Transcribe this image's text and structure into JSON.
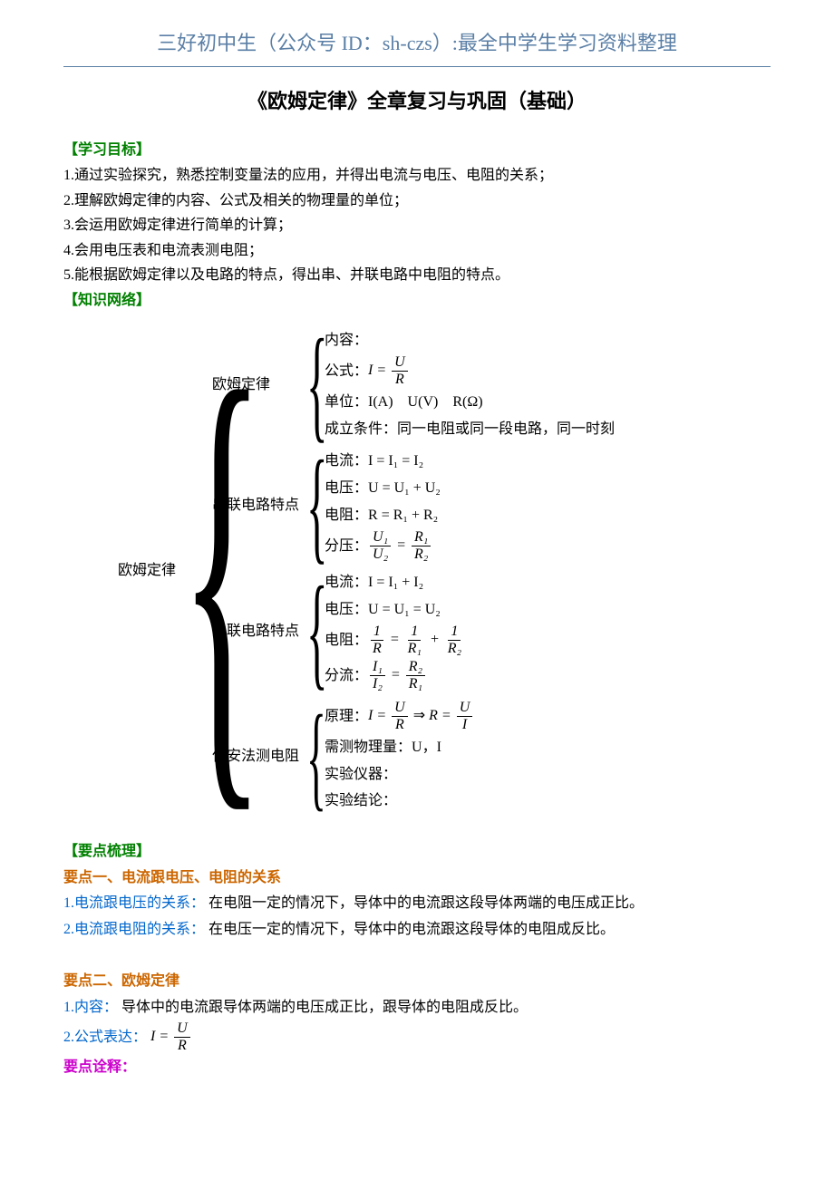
{
  "header": "三好初中生（公众号 ID：sh-czs）:最全中学生学习资料整理",
  "title": "《欧姆定律》全章复习与巩固（基础）",
  "sections": {
    "goals_label": "【学习目标】",
    "goals": [
      "1.通过实验探究，熟悉控制变量法的应用，并得出电流与电压、电阻的关系；",
      "2.理解欧姆定律的内容、公式及相关的物理量的单位；",
      "3.会运用欧姆定律进行简单的计算；",
      "4.会用电压表和电流表测电阻；",
      "5.能根据欧姆定律以及电路的特点，得出串、并联电路中电阻的特点。"
    ],
    "network_label": "【知识网络】",
    "tree": {
      "root": "欧姆定律",
      "b1": {
        "label": "欧姆定律",
        "i1": "内容：",
        "i2_prefix": "公式：",
        "i2_I": "I",
        "i2_U": "U",
        "i2_R": "R",
        "i3": "单位：I(A)　U(V)　R(Ω)",
        "i4": "成立条件：同一电阻或同一段电路，同一时刻"
      },
      "b2": {
        "label": "串联电路特点",
        "i1": "电流：I = I₁ = I₂",
        "i2": "电压：U = U₁ + U₂",
        "i3": "电阻：R = R₁ + R₂",
        "i4_prefix": "分压：",
        "i4_u1": "U₁",
        "i4_u2": "U₂",
        "i4_r1": "R₁",
        "i4_r2": "R₂"
      },
      "b3": {
        "label": "并联电路特点",
        "i1": "电流：I = I₁ + I₂",
        "i2": "电压：U = U₁ = U₂",
        "i3_prefix": "电阻：",
        "i3_one": "1",
        "i3_R": "R",
        "i3_R1": "R₁",
        "i3_R2": "R₂",
        "i4_prefix": "分流：",
        "i4_I1": "I₁",
        "i4_I2": "I₂",
        "i4_R2": "R₂",
        "i4_R1": "R₁"
      },
      "b4": {
        "label": "伏安法测电阻",
        "i1_prefix": "原理：",
        "i1_I": "I",
        "i1_U": "U",
        "i1_R": "R",
        "i1_arrow": " ⇒ ",
        "i2": "需测物理量：U，I",
        "i3": "实验仪器：",
        "i4": "实验结论："
      }
    },
    "points_label": "【要点梳理】",
    "point1_title": "要点一、电流跟电压、电阻的关系",
    "point1_1_label": "1.电流跟电压的关系：",
    "point1_1_text": "在电阻一定的情况下，导体中的电流跟这段导体两端的电压成正比。",
    "point1_2_label": "2.电流跟电阻的关系：",
    "point1_2_text": "在电压一定的情况下，导体中的电流跟这段导体的电阻成反比。",
    "point2_title": "要点二、欧姆定律",
    "point2_1_label": "1.内容：",
    "point2_1_text": "导体中的电流跟导体两端的电压成正比，跟导体的电阻成反比。",
    "point2_2_label": "2.公式表达：",
    "point2_2_I": "I",
    "point2_2_U": "U",
    "point2_2_R": "R",
    "point_note": "要点诠释："
  }
}
